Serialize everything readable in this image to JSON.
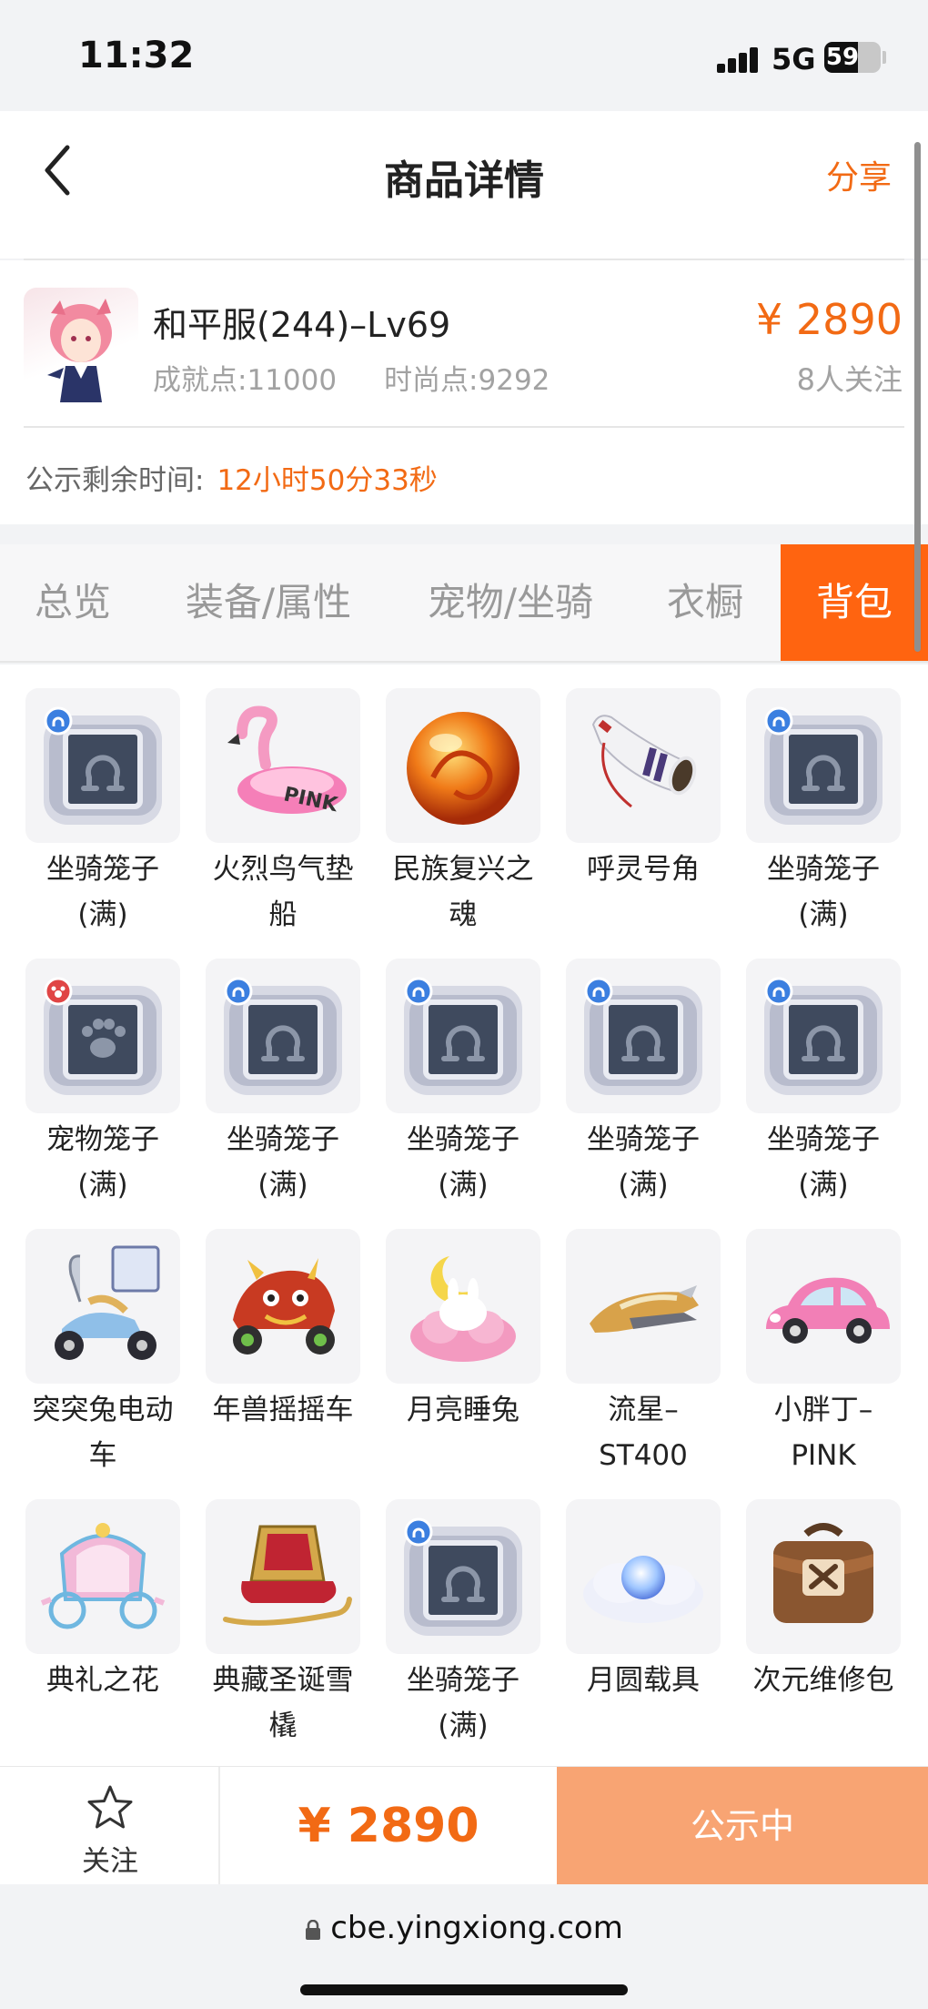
{
  "status": {
    "time": "11:32",
    "network": "5G",
    "battery": "59",
    "battery_level": 0.59
  },
  "nav": {
    "title": "商品详情",
    "share": "分享"
  },
  "product": {
    "name": "和平服(244)–Lv69",
    "achievement": "成就点:11000",
    "fashion": "时尚点:9292",
    "price": "¥ 2890",
    "followers": "8人关注",
    "countdown_label": "公示剩余时间:",
    "countdown_value": "12小时50分33秒"
  },
  "tabs": [
    {
      "label": "总览",
      "active": false
    },
    {
      "label": "装备/属性",
      "active": false
    },
    {
      "label": "宠物/坐骑",
      "active": false
    },
    {
      "label": "衣橱",
      "active": false
    },
    {
      "label": "背包",
      "active": true
    }
  ],
  "items": [
    {
      "name": "坐骑笼子\n(满)",
      "icon": "mount-cage-icon"
    },
    {
      "name": "火烈鸟气垫船",
      "icon": "flamingo-hovercraft-icon"
    },
    {
      "name": "民族复兴之魂",
      "icon": "dragon-orb-icon"
    },
    {
      "name": "呼灵号角",
      "icon": "horn-icon"
    },
    {
      "name": "坐骑笼子\n(满)",
      "icon": "mount-cage-icon"
    },
    {
      "name": "宠物笼子\n(满)",
      "icon": "pet-cage-icon"
    },
    {
      "name": "坐骑笼子\n(满)",
      "icon": "mount-cage-icon"
    },
    {
      "name": "坐骑笼子\n(满)",
      "icon": "mount-cage-icon"
    },
    {
      "name": "坐骑笼子\n(满)",
      "icon": "mount-cage-icon"
    },
    {
      "name": "坐骑笼子\n(满)",
      "icon": "mount-cage-icon"
    },
    {
      "name": "突突兔电动车",
      "icon": "scooter-icon"
    },
    {
      "name": "年兽摇摇车",
      "icon": "beast-cart-icon"
    },
    {
      "name": "月亮睡兔",
      "icon": "moon-rabbit-icon"
    },
    {
      "name": "流星–\nST400",
      "icon": "meteor-craft-icon"
    },
    {
      "name": "小胖丁–\nPINK",
      "icon": "pink-car-icon"
    },
    {
      "name": "典礼之花",
      "icon": "carriage-icon"
    },
    {
      "name": "典藏圣诞雪橇",
      "icon": "sleigh-icon"
    },
    {
      "name": "坐骑笼子\n(满)",
      "icon": "mount-cage-icon"
    },
    {
      "name": "月圆载具",
      "icon": "moon-cloud-icon"
    },
    {
      "name": "次元维修包",
      "icon": "repair-bag-icon"
    }
  ],
  "bottom": {
    "follow": "关注",
    "price": "¥ 2890",
    "status": "公示中"
  },
  "browser": {
    "url": "cbe.yingxiong.com"
  },
  "colors": {
    "accent": "#f26a14",
    "tab_active": "#ff6410",
    "status_button": "#f8a473"
  }
}
